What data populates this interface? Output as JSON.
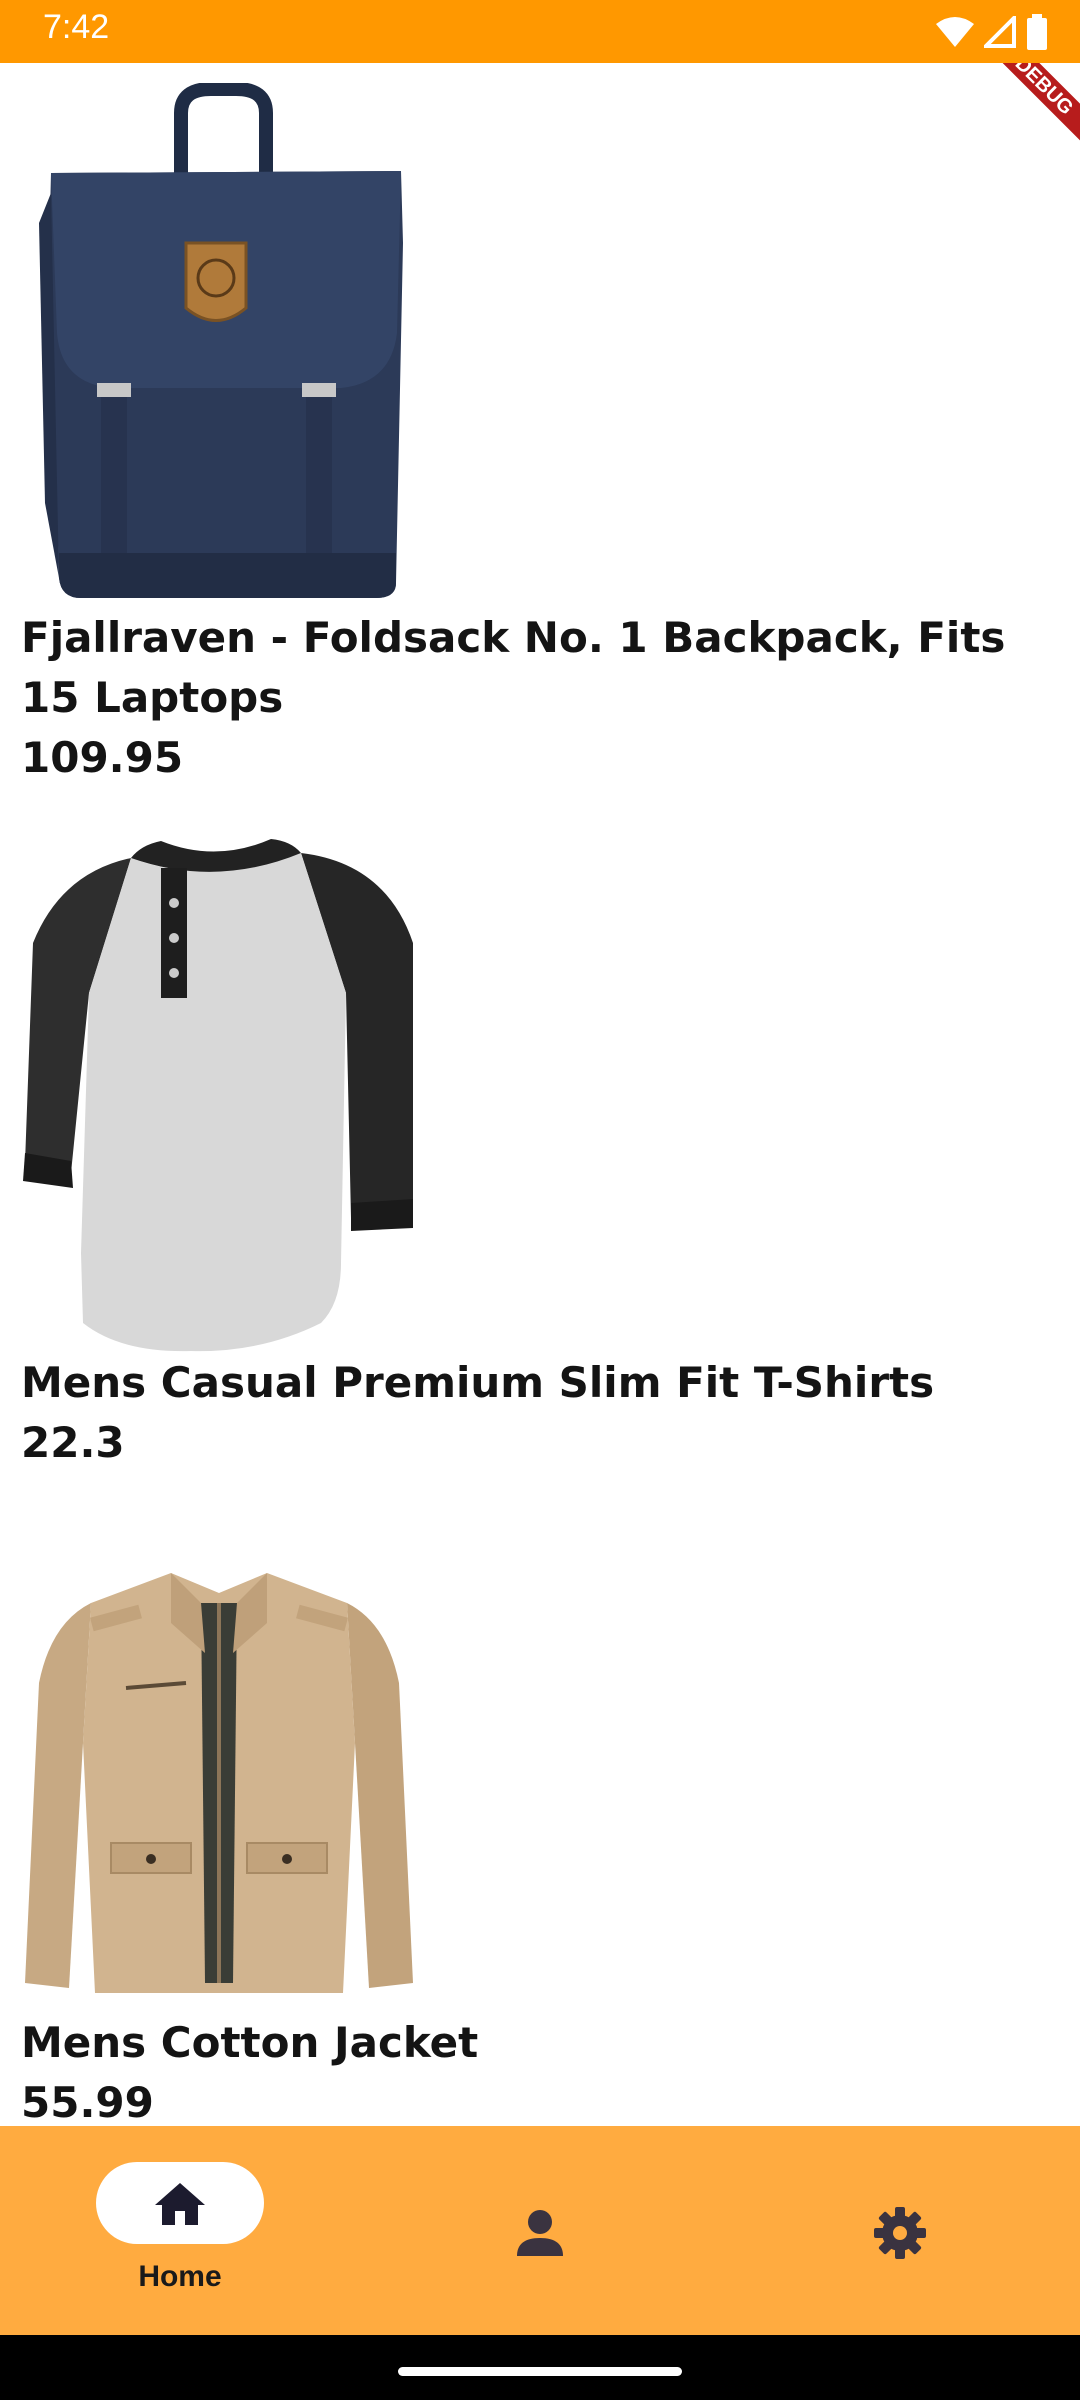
{
  "status_bar": {
    "time": "7:42",
    "icons": [
      "wifi-icon",
      "signal-icon",
      "battery-icon"
    ]
  },
  "debug_banner": {
    "label": "DEBUG"
  },
  "products": [
    {
      "title": "Fjallraven - Foldsack No. 1 Backpack, Fits 15 Laptops",
      "price": "109.95",
      "image": "navy-backpack"
    },
    {
      "title": "Mens Casual Premium Slim Fit T-Shirts",
      "price": "22.3",
      "image": "raglan-tshirt"
    },
    {
      "title": "Mens Cotton Jacket",
      "price": "55.99",
      "image": "khaki-jacket"
    }
  ],
  "bottom_nav": {
    "items": [
      {
        "label": "Home",
        "icon": "home-icon",
        "selected": true
      },
      {
        "label": "",
        "icon": "person-icon",
        "selected": false
      },
      {
        "label": "",
        "icon": "gear-icon",
        "selected": false
      }
    ]
  },
  "colors": {
    "status_bar": "#FF9800",
    "bottom_nav": "#FFAB40",
    "text": "#141414"
  }
}
